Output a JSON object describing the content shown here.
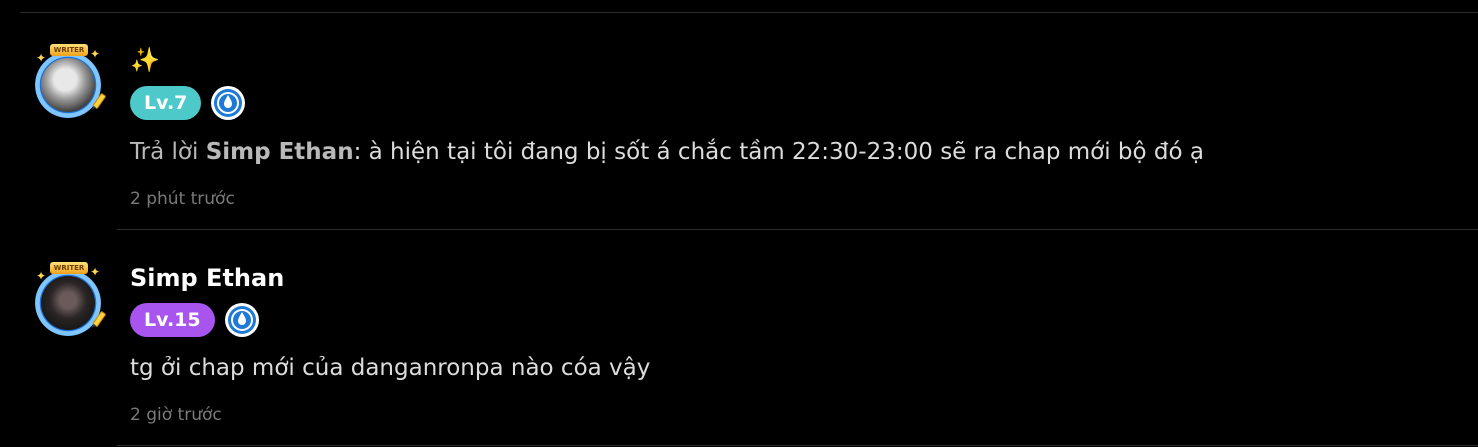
{
  "comments": [
    {
      "username": "✨",
      "level": "Lv.7",
      "level_color": "#4ec9c9",
      "avatar_frame_label": "WRITER",
      "reply_prefix": "Trả lời",
      "reply_to": "Simp Ethan",
      "reply_sep": ":",
      "text": " à hiện tại tôi đang bị sốt á chắc tầm 22:30-23:00 sẽ ra chap mới bộ đó ạ",
      "timestamp": "2 phút trước",
      "rank_icon": "droplet-rank-icon"
    },
    {
      "username": "Simp Ethan",
      "level": "Lv.15",
      "level_color": "#a855f0",
      "avatar_frame_label": "WRITER",
      "text": "tg ởi chap mới của danganronpa nào cóa vậy",
      "timestamp": "2 giờ trước",
      "rank_icon": "droplet-rank-icon"
    }
  ],
  "colors": {
    "background": "#000000",
    "divider": "#2a2a2a",
    "rank_blue": "#1e7ad6"
  }
}
